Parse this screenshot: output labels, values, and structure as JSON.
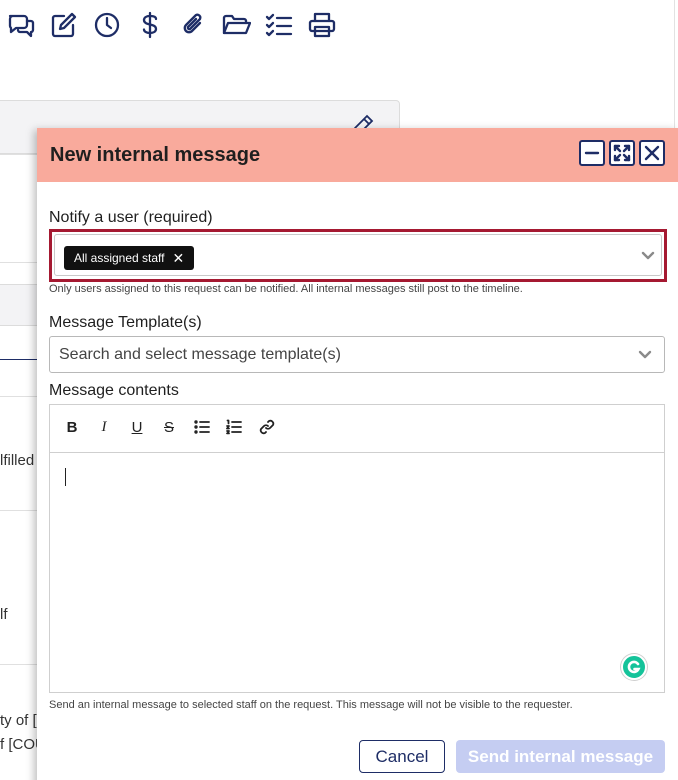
{
  "toolbar": {
    "icons": [
      "chat-bubbles-icon",
      "edit-note-icon",
      "clock-icon",
      "dollar-icon",
      "paperclip-icon",
      "folder-open-icon",
      "checklist-icon",
      "printer-icon"
    ]
  },
  "background": {
    "fragments": [
      "lfilled",
      "lf",
      "ty of [",
      "f [COU"
    ]
  },
  "modal": {
    "title": "New internal message",
    "window_controls": [
      "minimize-icon",
      "expand-icon",
      "close-icon"
    ],
    "notify": {
      "label": "Notify a user (required)",
      "chip": "All assigned staff",
      "chip_remove": "✕",
      "help": "Only users assigned to this request can be notified. All internal messages still post to the timeline."
    },
    "template": {
      "label": "Message Template(s)",
      "placeholder": "Search and select message template(s)"
    },
    "contents": {
      "label": "Message contents",
      "toolbar": [
        "B",
        "I",
        "U",
        "S"
      ],
      "help": "Send an internal message to selected staff on the request. This message will not be visible to the requester."
    },
    "buttons": {
      "cancel": "Cancel",
      "send": "Send internal message"
    }
  },
  "colors": {
    "header_bg": "#f9aa9c",
    "accent": "#1e2d66",
    "focus_border": "#a51931",
    "send_disabled": "#c5cdf2",
    "grammarly": "#15c39a"
  }
}
